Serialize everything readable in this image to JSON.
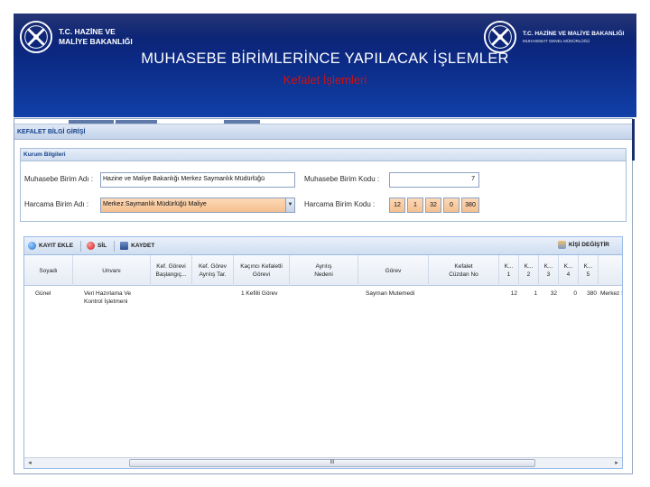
{
  "banner": {
    "org_left": "T.C. HAZİNE VE MALİYE BAKANLIĞI",
    "org_right_line1": "T.C. HAZİNE VE MALİYE BAKANLIĞI",
    "org_right_line2": "MUHASEBAT GENEL MÜDÜRLÜĞÜ",
    "title": "MUHASEBE BİRİMLERİNCE YAPILACAK İŞLEMLER",
    "subtitle": "Kefalet İşlemleri",
    "colors": {
      "title": "#ffffff",
      "subtitle": "#cc1111",
      "background": "#0c2a85"
    }
  },
  "app": {
    "section_title": "KEFALET BİLGİ GİRİŞİ",
    "kurum": {
      "title": "Kurum Bilgileri",
      "muhasebe_birim_adi_label": "Muhasebe Birim Adı :",
      "muhasebe_birim_adi_value": "Hazine ve Maliye Bakanlığı Merkez Saymanlık Müdürlüğü",
      "harcama_birim_adi_label": "Harcama Birim Adı :",
      "harcama_birim_adi_value": "Merkez Saymanlık Müdürlüğü Maliye",
      "muhasebe_birim_kodu_label": "Muhasebe Birim Kodu :",
      "muhasebe_birim_kodu_value": "7",
      "harcama_birim_kodu_label": "Harcama Birim Kodu :",
      "harcama_birim_kodu_values": [
        "12",
        "1",
        "32",
        "0",
        "380"
      ]
    },
    "toolbar": {
      "kayit_ekle": "KAYIT EKLE",
      "sil": "SİL",
      "kaydet": "KAYDET",
      "kisi_degistir": "KİŞİ DEĞİŞTİR"
    },
    "grid": {
      "headers": [
        [
          "Soyadı"
        ],
        [
          "Unvanı"
        ],
        [
          "Kef. Görevi",
          "Başlangıç..."
        ],
        [
          "Kef. Görev",
          "Ayrılış Tar."
        ],
        [
          "Kaçıncı Kefaletli",
          "Görevi"
        ],
        [
          "Ayrılış",
          "Nedeni"
        ],
        [
          "Görev"
        ],
        [
          "Kefalet",
          "Cüzdan No"
        ],
        [
          "K...",
          "1"
        ],
        [
          "K...",
          "2"
        ],
        [
          "K...",
          "3"
        ],
        [
          "K...",
          "4"
        ],
        [
          "K...",
          "5"
        ],
        [
          ""
        ]
      ],
      "rows": [
        {
          "soyadi": "Günel",
          "unvani_1": "Veri Hazırlama Ve",
          "unvani_2": "Kontrol İşletmeni",
          "kef_gorevi_baslangic": "",
          "kef_gorev_ayrilis": "",
          "kacinci": "1 Kefilli Görev",
          "ayrilis_nedeni": "",
          "gorev": "Sayman Mutemedi",
          "cuzdan_no": "",
          "k1": "12",
          "k2": "1",
          "k3": "32",
          "k4": "0",
          "k5": "380",
          "last": "Merkez S"
        }
      ],
      "scroll_thumb_glyph": "III"
    }
  }
}
